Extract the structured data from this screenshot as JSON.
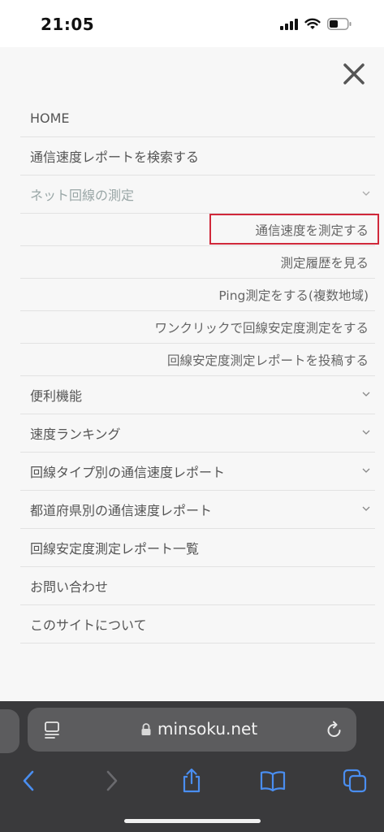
{
  "status_bar": {
    "time": "21:05"
  },
  "menu": {
    "items": [
      {
        "label": "HOME",
        "expandable": false
      },
      {
        "label": "通信速度レポートを検索する",
        "expandable": false
      },
      {
        "label": "ネット回線の測定",
        "expandable": true,
        "expanded": true
      }
    ],
    "sub_items": [
      {
        "label": "通信速度を測定する"
      },
      {
        "label": "測定履歴を見る"
      },
      {
        "label": "Ping測定をする(複数地域)"
      },
      {
        "label": "ワンクリックで回線安定度測定をする"
      },
      {
        "label": "回線安定度測定レポートを投稿する"
      }
    ],
    "items_after": [
      {
        "label": "便利機能",
        "expandable": true
      },
      {
        "label": "速度ランキング",
        "expandable": true
      },
      {
        "label": "回線タイプ別の通信速度レポート",
        "expandable": true
      },
      {
        "label": "都道府県別の通信速度レポート",
        "expandable": true
      },
      {
        "label": "回線安定度測定レポート一覧",
        "expandable": false
      },
      {
        "label": "お問い合わせ",
        "expandable": false
      },
      {
        "label": "このサイトについて",
        "expandable": false
      }
    ]
  },
  "browser": {
    "url": "minsoku.net",
    "accent_color": "#4a8ef0",
    "highlight_color": "#d0283a"
  }
}
